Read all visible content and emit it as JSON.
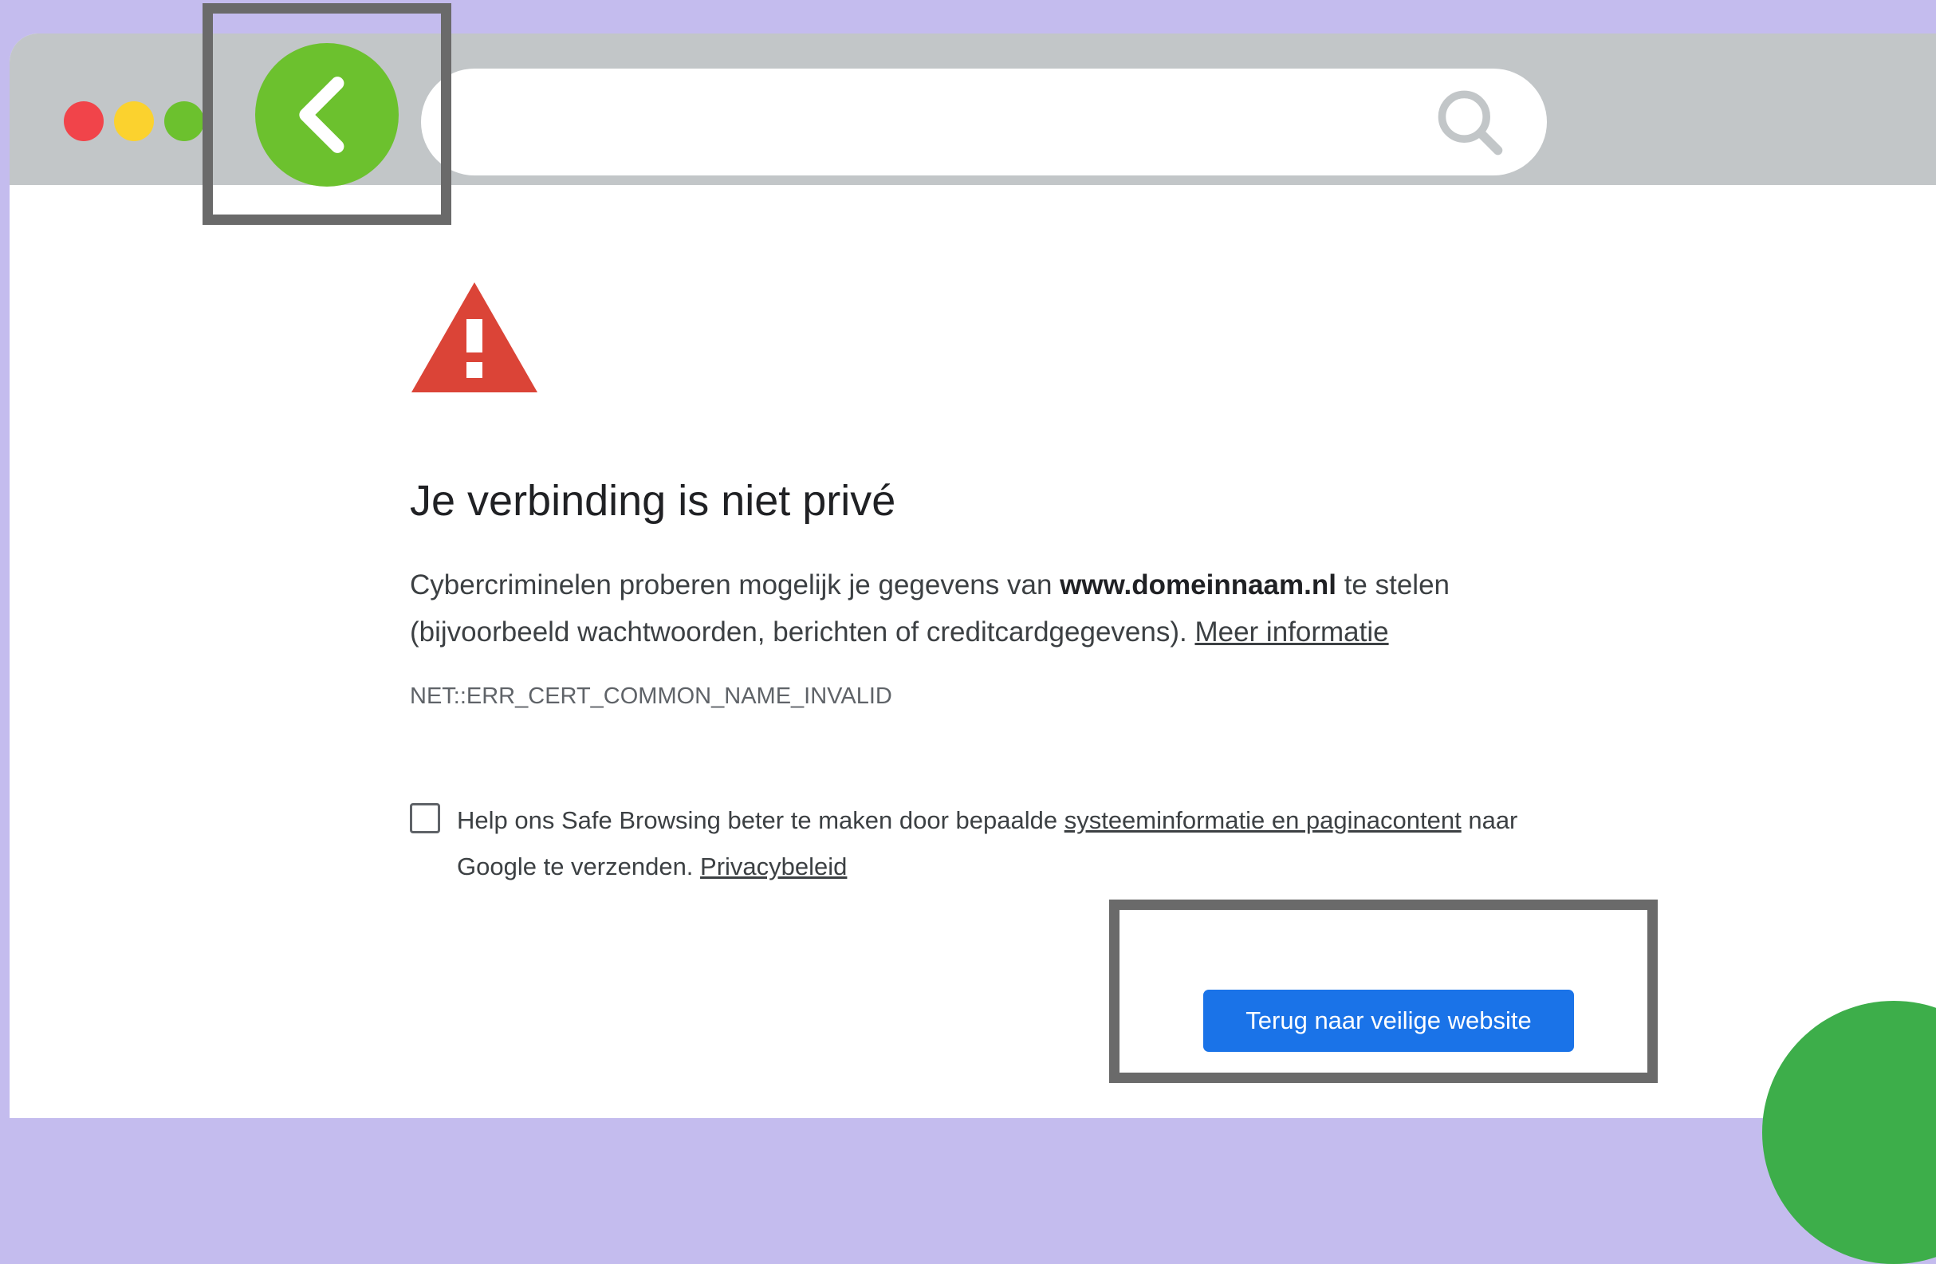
{
  "colors": {
    "page_background": "#c4bcee",
    "titlebar": "#c2c6c8",
    "back_button": "#6cc12e",
    "warning_red": "#db4437",
    "primary_button": "#1a73e8",
    "highlight_border": "#6a6a6a",
    "decor_circle": "#3dae4a"
  },
  "window_controls": {
    "close": "#f1444a",
    "minimize": "#fbd22e",
    "maximize": "#6cc12e"
  },
  "toolbar": {
    "back_icon": "chevron-left-icon",
    "address_value": "",
    "search_icon": "search-icon"
  },
  "error_page": {
    "icon": "warning-triangle-icon",
    "heading": "Je verbinding is niet privé",
    "description_before": "Cybercriminelen proberen mogelijk je gegevens van ",
    "description_domain": "www.domeinnaam.nl",
    "description_after": " te stelen (bijvoorbeeld wachtwoorden, berichten of creditcardgegevens). ",
    "more_info_link": "Meer informatie",
    "error_code": "NET::ERR_CERT_COMMON_NAME_INVALID",
    "safe_browsing": {
      "checked": false,
      "text_before": "Help ons Safe Browsing beter te maken door bepaalde ",
      "system_info_link": "systeeminformatie en paginacontent",
      "text_after": " naar Google te verzenden. ",
      "privacy_link": "Privacybeleid"
    },
    "back_button_label": "Terug naar veilige website"
  }
}
